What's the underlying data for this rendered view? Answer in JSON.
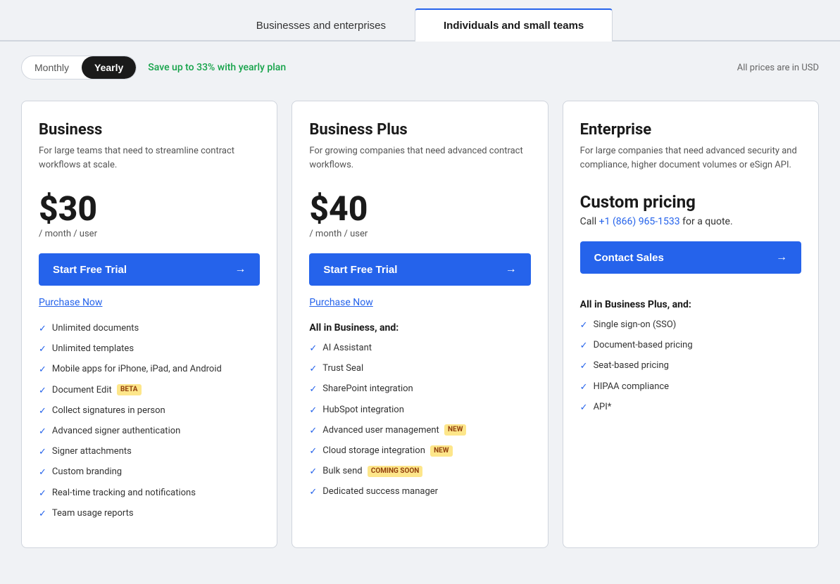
{
  "tabs": [
    {
      "id": "businesses",
      "label": "Businesses and enterprises",
      "active": false
    },
    {
      "id": "individuals",
      "label": "Individuals and small teams",
      "active": true
    }
  ],
  "billing": {
    "monthly_label": "Monthly",
    "yearly_label": "Yearly",
    "active": "yearly",
    "save_text": "Save up to 33% with yearly plan",
    "currency_note": "All prices are in USD"
  },
  "plans": [
    {
      "id": "business",
      "name": "Business",
      "description": "For large teams that need to streamline contract workflows at scale.",
      "price": "$30",
      "price_sub": "/ month / user",
      "custom": false,
      "trial_btn": "Start Free Trial",
      "purchase_link": "Purchase Now",
      "features_header": null,
      "features": [
        {
          "text": "Unlimited documents",
          "badge": null
        },
        {
          "text": "Unlimited templates",
          "badge": null
        },
        {
          "text": "Mobile apps for iPhone, iPad, and Android",
          "badge": null
        },
        {
          "text": "Document Edit",
          "badge": "BETA"
        },
        {
          "text": "Collect signatures in person",
          "badge": null
        },
        {
          "text": "Advanced signer authentication",
          "badge": null
        },
        {
          "text": "Signer attachments",
          "badge": null
        },
        {
          "text": "Custom branding",
          "badge": null
        },
        {
          "text": "Real-time tracking and notifications",
          "badge": null
        },
        {
          "text": "Team usage reports",
          "badge": null
        }
      ]
    },
    {
      "id": "business-plus",
      "name": "Business Plus",
      "description": "For growing companies that need advanced contract workflows.",
      "price": "$40",
      "price_sub": "/ month / user",
      "custom": false,
      "trial_btn": "Start Free Trial",
      "purchase_link": "Purchase Now",
      "features_header": "All in Business, and:",
      "features": [
        {
          "text": "AI Assistant",
          "badge": null
        },
        {
          "text": "Trust Seal",
          "badge": null
        },
        {
          "text": "SharePoint integration",
          "badge": null
        },
        {
          "text": "HubSpot integration",
          "badge": null
        },
        {
          "text": "Advanced user management",
          "badge": "NEW"
        },
        {
          "text": "Cloud storage integration",
          "badge": "NEW"
        },
        {
          "text": "Bulk send",
          "badge": "COMING SOON"
        },
        {
          "text": "Dedicated success manager",
          "badge": null
        }
      ]
    },
    {
      "id": "enterprise",
      "name": "Enterprise",
      "description": "For large companies that need advanced security and compliance, higher document volumes or eSign API.",
      "custom": true,
      "custom_pricing_label": "Custom pricing",
      "custom_call_text": "Call ",
      "custom_phone": "+1 (866) 965-1533",
      "custom_call_suffix": " for a quote.",
      "contact_btn": "Contact Sales",
      "features_header": "All in Business Plus, and:",
      "features": [
        {
          "text": "Single sign-on (SSO)",
          "badge": null
        },
        {
          "text": "Document-based pricing",
          "badge": null
        },
        {
          "text": "Seat-based pricing",
          "badge": null
        },
        {
          "text": "HIPAA compliance",
          "badge": null
        },
        {
          "text": "API*",
          "badge": null
        }
      ]
    }
  ]
}
